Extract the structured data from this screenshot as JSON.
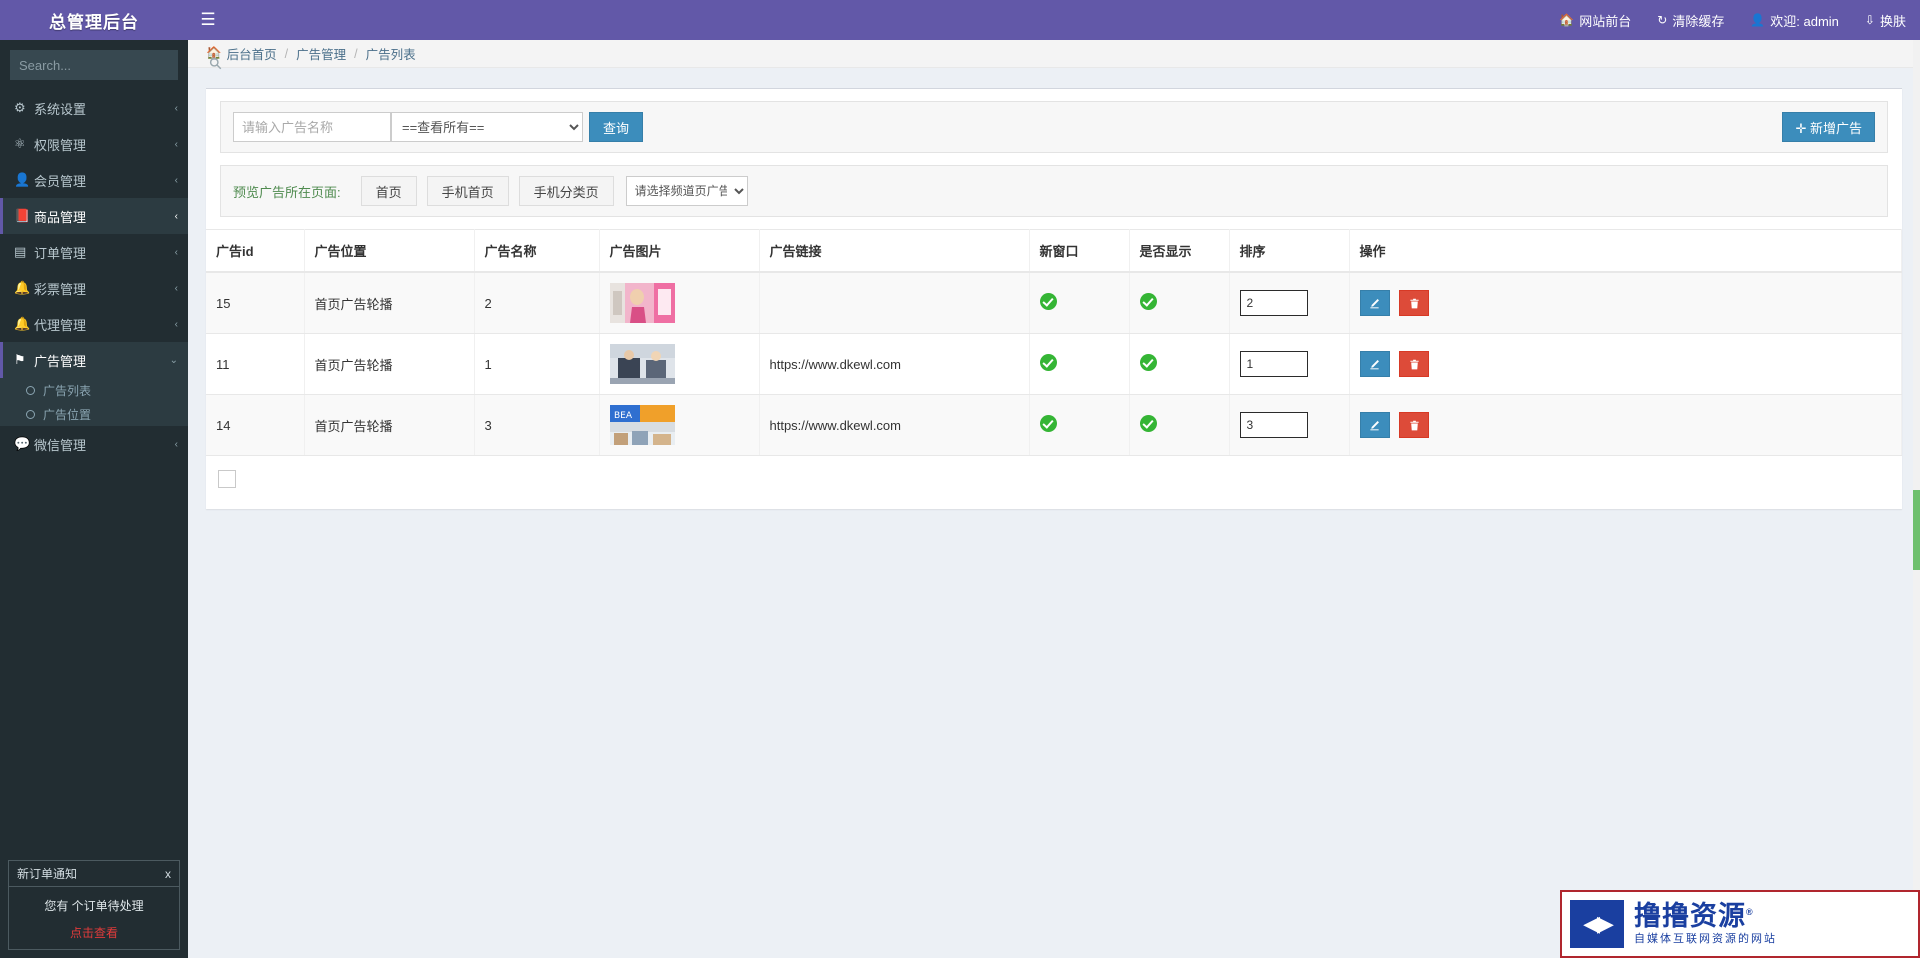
{
  "brand": {
    "title": "总管理后台"
  },
  "sidebar": {
    "search_placeholder": "Search...",
    "search_icon": "search-icon",
    "items": [
      {
        "label": "系统设置",
        "icon": "gear-icon",
        "arrow": "‹",
        "state": "closed"
      },
      {
        "label": "权限管理",
        "icon": "sliders-icon",
        "arrow": "‹",
        "state": "closed"
      },
      {
        "label": "会员管理",
        "icon": "user-icon",
        "arrow": "‹",
        "state": "closed"
      },
      {
        "label": "商品管理",
        "icon": "book-icon",
        "arrow": "‹",
        "state": "active"
      },
      {
        "label": "订单管理",
        "icon": "order-icon",
        "arrow": "‹",
        "state": "closed"
      },
      {
        "label": "彩票管理",
        "icon": "bell-icon",
        "arrow": "‹",
        "state": "closed"
      },
      {
        "label": "代理管理",
        "icon": "bell-icon",
        "arrow": "‹",
        "state": "closed"
      },
      {
        "label": "广告管理",
        "icon": "flag-icon",
        "arrow": "⌄",
        "state": "open"
      },
      {
        "label": "微信管理",
        "icon": "wechat-icon",
        "arrow": "‹",
        "state": "closed"
      }
    ],
    "submenu": [
      {
        "label": "广告列表",
        "icon": "circle-icon",
        "active": true
      },
      {
        "label": "广告位置",
        "icon": "circle-icon",
        "active": false
      }
    ]
  },
  "notification": {
    "title": "新订单通知",
    "close_label": "x",
    "line_prefix": "您有",
    "count": "",
    "line_suffix": "个订单待处理",
    "link": "点击查看"
  },
  "topbar": {
    "menu_toggle_icon": "hamburger-icon",
    "links": [
      {
        "label": "网站前台",
        "icon": "home-icon"
      },
      {
        "label": "清除缓存",
        "icon": "refresh-icon"
      },
      {
        "label": "欢迎: admin",
        "icon": "user-icon"
      },
      {
        "label": "换肤",
        "icon": "skin-icon"
      }
    ]
  },
  "breadcrumb": {
    "home_icon": "home-icon",
    "items": [
      "后台首页",
      "广告管理",
      "广告列表"
    ],
    "separator": "/"
  },
  "filter": {
    "keyword_value": "",
    "keyword_placeholder": "请输入广告名称",
    "position_selected": "==查看所有==",
    "query_label": "查询",
    "add_label": "✛ 新增广告"
  },
  "preview": {
    "label": "预览广告所在页面:",
    "buttons": [
      "首页",
      "手机首页",
      "手机分类页"
    ],
    "channel_selected": "请选择频道页广告"
  },
  "table": {
    "headers": [
      "广告id",
      "广告位置",
      "广告名称",
      "广告图片",
      "广告链接",
      "新窗口",
      "是否显示",
      "排序",
      "操作"
    ],
    "rows": [
      {
        "id": "15",
        "position": "首页广告轮播",
        "name": "2",
        "image_alt": "广告图片-15",
        "link": "",
        "new_window": true,
        "visible": true,
        "sort": "2",
        "edit_icon": "pencil-icon",
        "delete_icon": "trash-icon"
      },
      {
        "id": "11",
        "position": "首页广告轮播",
        "name": "1",
        "image_alt": "广告图片-11",
        "link": "https://www.dkewl.com",
        "new_window": true,
        "visible": true,
        "sort": "1",
        "edit_icon": "pencil-icon",
        "delete_icon": "trash-icon"
      },
      {
        "id": "14",
        "position": "首页广告轮播",
        "name": "3",
        "image_alt": "广告图片-14",
        "link": "https://www.dkewl.com",
        "new_window": true,
        "visible": true,
        "sort": "3",
        "edit_icon": "pencil-icon",
        "delete_icon": "trash-icon"
      }
    ],
    "select_all_checked": false
  },
  "watermark": {
    "title": "撸撸资源",
    "subtitle": "自媒体互联网资源的网站",
    "registered": "®"
  },
  "colors": {
    "brand_purple": "#6258a8",
    "sidebar_dark": "#222d32",
    "accent_blue": "#3c8dbc",
    "danger_red": "#dd4b39",
    "success_green": "#35b535"
  }
}
